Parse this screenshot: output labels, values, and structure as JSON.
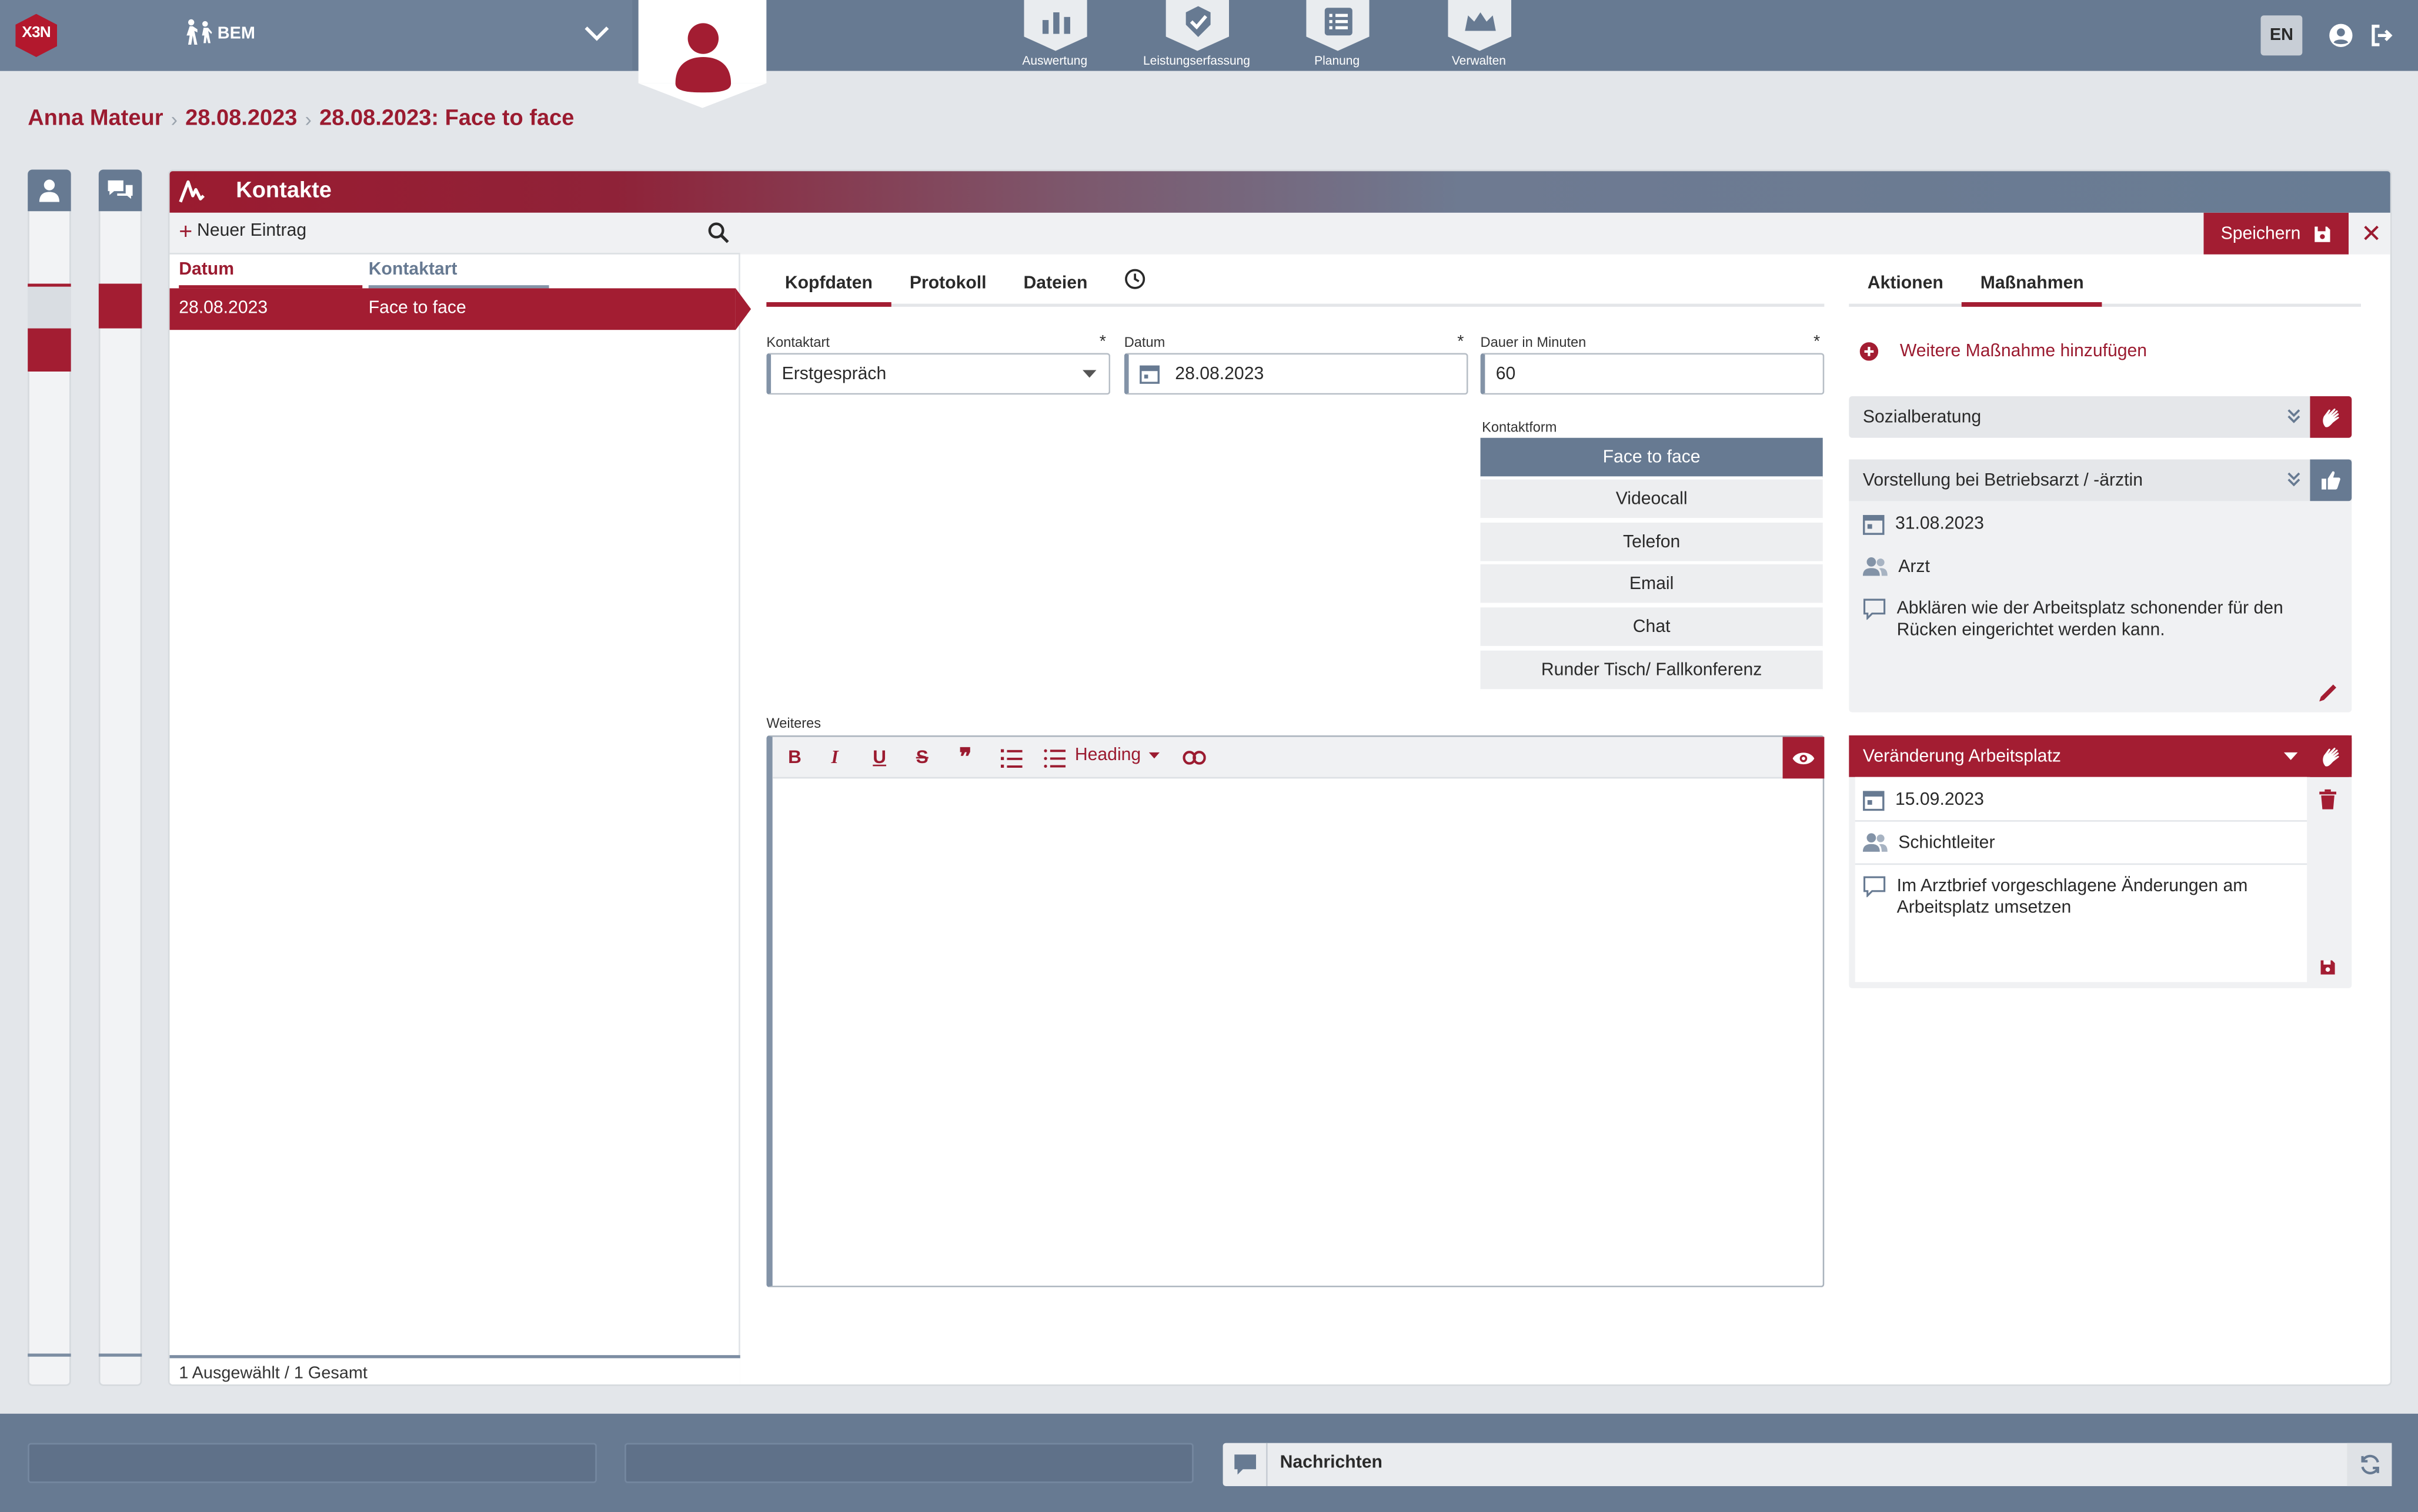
{
  "app": {
    "logo_text": "X3N",
    "module_label": "BEM",
    "lang": "EN"
  },
  "nav": [
    {
      "label": "Auswertung",
      "icon": "chart-bars-icon"
    },
    {
      "label": "Leistungserfassung",
      "icon": "check-shield-icon"
    },
    {
      "label": "Planung",
      "icon": "list-icon"
    },
    {
      "label": "Verwalten",
      "icon": "crown-icon"
    }
  ],
  "breadcrumb": [
    "Anna Mateur",
    "28.08.2023",
    "28.08.2023: Face to face"
  ],
  "panel": {
    "title": "Kontakte",
    "new_entry": "Neuer Eintrag",
    "columns": [
      "Datum",
      "Kontaktart"
    ],
    "rows": [
      {
        "datum": "28.08.2023",
        "kontaktart": "Face to face"
      }
    ],
    "footer": "1 Ausgewählt / 1 Gesamt",
    "save": "Speichern",
    "close": "✕"
  },
  "detail": {
    "tabs": [
      "Kopfdaten",
      "Protokoll",
      "Dateien"
    ],
    "kontaktart": {
      "label": "Kontaktart",
      "value": "Erstgespräch"
    },
    "datum": {
      "label": "Datum",
      "value": "28.08.2023"
    },
    "dauer": {
      "label": "Dauer in Minuten",
      "value": "60"
    },
    "required_mark": "*",
    "kontaktform": {
      "label": "Kontaktform",
      "options": [
        "Face to face",
        "Videocall",
        "Telefon",
        "Email",
        "Chat",
        "Runder Tisch/ Fallkonferenz"
      ],
      "selected": "Face to face"
    },
    "weiteres": {
      "label": "Weiteres",
      "heading_select": "Heading"
    }
  },
  "right": {
    "tabs": [
      "Aktionen",
      "Maßnahmen"
    ],
    "add_label": "Weitere Maßnahme hinzufügen",
    "massnahmen": [
      {
        "title": "Sozialberatung"
      },
      {
        "title": "Vorstellung bei Betriebsarzt / -ärztin",
        "date": "31.08.2023",
        "person": "Arzt",
        "comment_1": "Abklären wie der Arbeitsplatz schonender für den",
        "comment_2": "Rücken eingerichtet werden kann."
      },
      {
        "title": "Veränderung Arbeitsplatz",
        "date": "15.09.2023",
        "person": "Schichtleiter",
        "comment_1": "Im Arztbrief vorgeschlagene Änderungen am",
        "comment_2": "Arbeitsplatz umsetzen"
      }
    ]
  },
  "footer": {
    "messages": "Nachrichten"
  },
  "colors": {
    "brand": "#a31d32",
    "slate": "#677a92"
  }
}
